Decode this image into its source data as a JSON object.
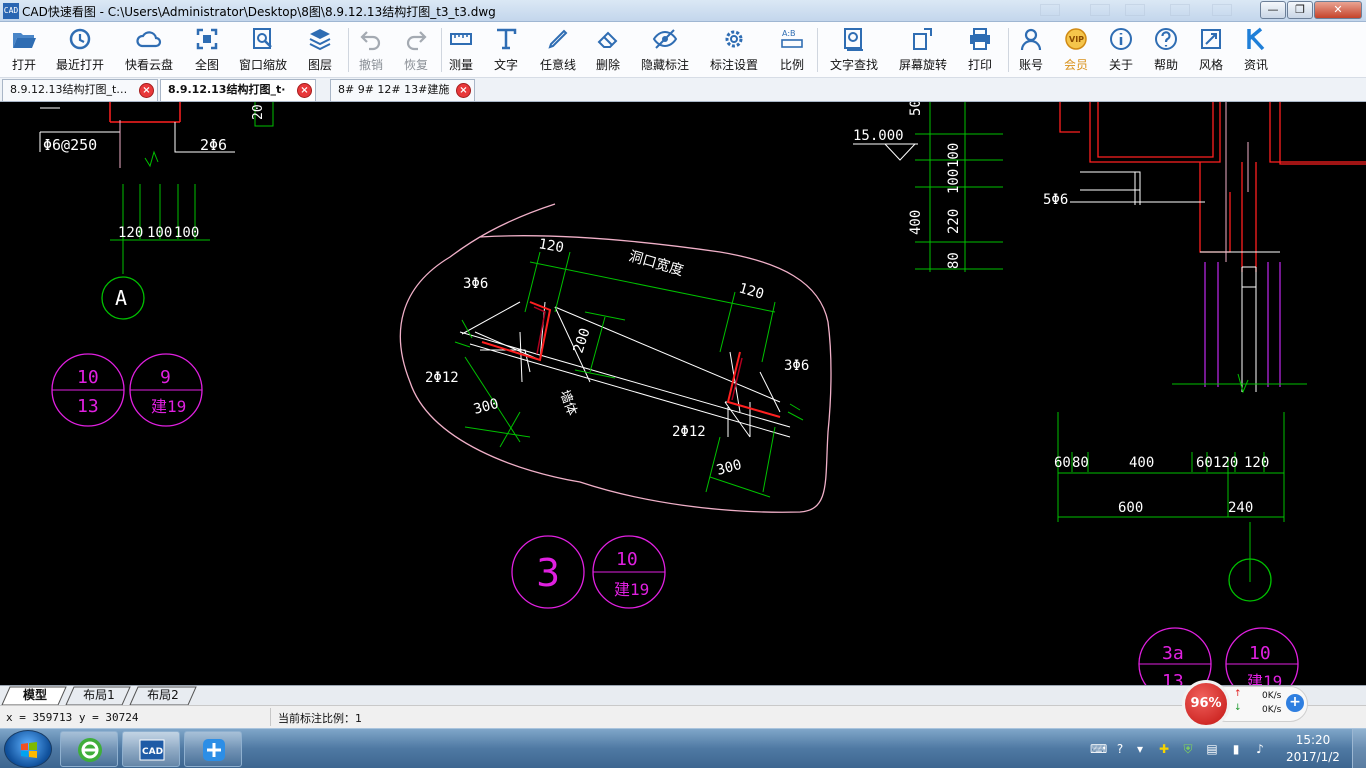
{
  "window": {
    "app_icon_text": "CAD",
    "title": "CAD快速看图 - C:\\Users\\Administrator\\Desktop\\8图\\8.9.12.13结构打图_t3_t3.dwg",
    "controls": {
      "minimize": "—",
      "maximize": "❐",
      "close": "✕"
    }
  },
  "toolbar": {
    "buttons": [
      {
        "label": "打开",
        "icon": "folder-open-icon"
      },
      {
        "label": "最近打开",
        "icon": "history-icon"
      },
      {
        "label": "快看云盘",
        "icon": "cloud-icon"
      },
      {
        "label": "全图",
        "icon": "fit-all-icon"
      },
      {
        "label": "窗口缩放",
        "icon": "zoom-window-icon"
      },
      {
        "label": "图层",
        "icon": "layers-icon"
      },
      {
        "label": "撤销",
        "icon": "undo-icon",
        "disabled": true
      },
      {
        "label": "恢复",
        "icon": "redo-icon",
        "disabled": true
      },
      {
        "label": "测量",
        "icon": "measure-icon"
      },
      {
        "label": "文字",
        "icon": "text-icon"
      },
      {
        "label": "任意线",
        "icon": "pen-icon"
      },
      {
        "label": "删除",
        "icon": "eraser-icon"
      },
      {
        "label": "隐藏标注",
        "icon": "eye-hidden-icon"
      },
      {
        "label": "标注设置",
        "icon": "gear-icon"
      },
      {
        "label": "比例",
        "icon": "scale-icon"
      },
      {
        "label": "文字查找",
        "icon": "find-text-icon"
      },
      {
        "label": "屏幕旋转",
        "icon": "rotate-screen-icon"
      },
      {
        "label": "打印",
        "icon": "printer-icon"
      },
      {
        "label": "账号",
        "icon": "user-icon"
      },
      {
        "label": "会员",
        "icon": "vip-icon"
      },
      {
        "label": "关于",
        "icon": "info-icon"
      },
      {
        "label": "帮助",
        "icon": "help-icon"
      },
      {
        "label": "风格",
        "icon": "style-icon"
      },
      {
        "label": "资讯",
        "icon": "news-icon"
      }
    ]
  },
  "tabs": [
    {
      "label": "8.9.12.13结构打图_t…",
      "active": false
    },
    {
      "label": "8.9.12.13结构打图_t·",
      "active": true
    },
    {
      "label": "8# 9# 12# 13#建施",
      "active": false
    }
  ],
  "drawing": {
    "top_left": {
      "rebar_left": "Φ6@250",
      "rebar_right": "2Φ6",
      "dim_a": "120",
      "dim_b": "100",
      "dim_c": "100",
      "partial_dim": "20",
      "axis_label": "A"
    },
    "detail_left": {
      "circle1_top": "10",
      "circle1_bottom": "13",
      "circle2_top": "9",
      "circle2_bottom": "建19"
    },
    "center_detail": {
      "dim_120_a": "120",
      "opening_width_label": "洞口宽度",
      "dim_120_b": "120",
      "rebar_3phi6_left": "3Φ6",
      "dim_200": "200",
      "rebar_2phi12_left": "2Φ12",
      "rebar_3phi6_right": "3Φ6",
      "dim_300_left": "300",
      "wall_label": "墙体",
      "rebar_2phi12_right": "2Φ12",
      "dim_300_right": "300"
    },
    "detail_center": {
      "circle_number": "3",
      "ref_top": "10",
      "ref_bottom": "建19"
    },
    "top_right_elevation": {
      "elevation": "15.000",
      "dim_50": "50",
      "dim_100_a": "100",
      "dim_100_b": "100",
      "dim_400": "400",
      "dim_220": "220",
      "dim_80": "80"
    },
    "right_section": {
      "rebar": "5Φ6",
      "dim_60_a": "60",
      "dim_80": "80",
      "dim_400": "400",
      "dim_60_b": "60",
      "dim_120_a": "120",
      "dim_120_b": "120",
      "dim_600": "600",
      "dim_240": "240"
    },
    "bottom_right_circles": {
      "c1_top": "3a",
      "c1_bottom": "13",
      "c2_top": "10",
      "c2_bottom": "建19"
    }
  },
  "layout_tabs": [
    "模型",
    "布局1",
    "布局2"
  ],
  "status": {
    "coords": "x = 359713  y = 30724",
    "scale": "当前标注比例：1"
  },
  "speed_widget": {
    "percent": "96%",
    "upload": "0K/s",
    "download": "0K/s",
    "up_arrow": "↑",
    "down_arrow": "↓",
    "plus": "+"
  },
  "taskbar": {
    "apps": [
      {
        "name": "browser-app",
        "icon": "ie-browser-icon"
      },
      {
        "name": "cad-app",
        "icon": "cad-viewer-icon",
        "text": "CAD"
      },
      {
        "name": "network-app",
        "icon": "network-icon"
      }
    ],
    "clock_time": "15:20",
    "clock_date": "2017/1/2"
  },
  "colors": {
    "green": "#00c000",
    "white": "#ffffff",
    "magenta": "#e020e0",
    "red": "#ff2020",
    "pink": "#f0b0c8",
    "darkred": "#b00020"
  }
}
